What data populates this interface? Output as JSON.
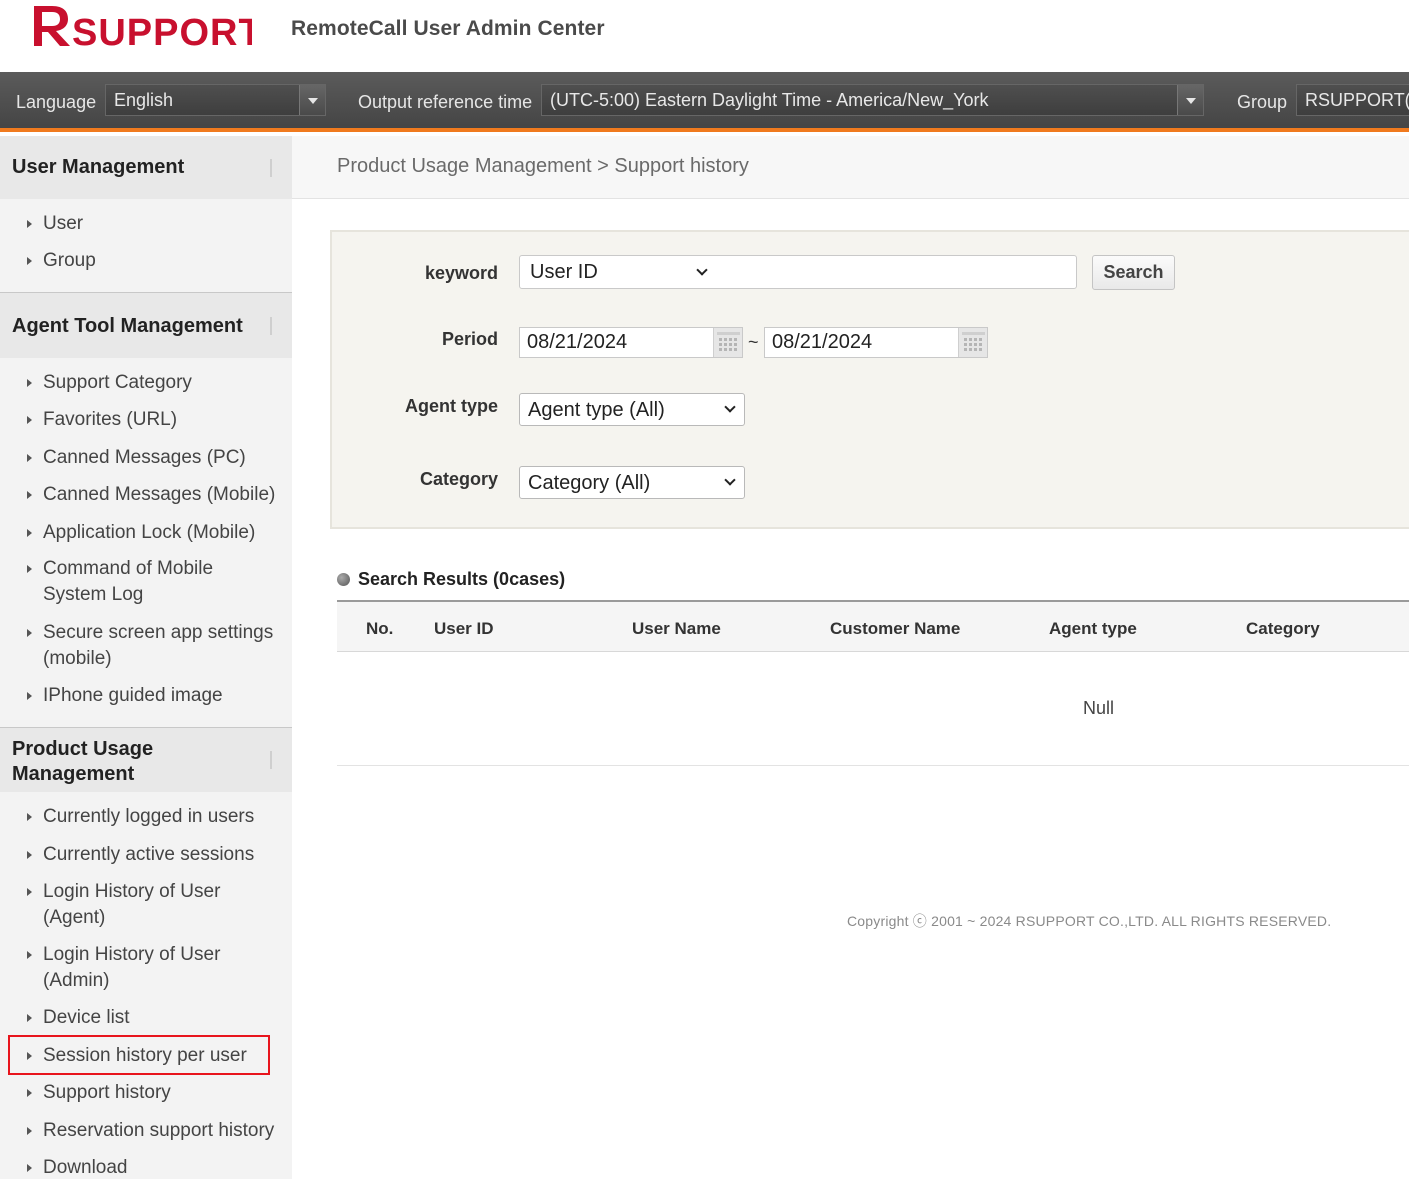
{
  "header": {
    "logo_text": "RSUPPORT",
    "app_title": "RemoteCall User Admin Center"
  },
  "topbar": {
    "language_label": "Language",
    "language_value": "English",
    "time_label": "Output reference time",
    "time_value": "(UTC-5:00) Eastern Daylight Time - America/New_York",
    "group_label": "Group",
    "group_value": "RSUPPORT("
  },
  "sidebar": {
    "user_management": {
      "title": "User Management",
      "items": [
        "User",
        "Group"
      ]
    },
    "agent_tool_management": {
      "title": "Agent Tool Management",
      "items": [
        "Support Category",
        "Favorites (URL)",
        "Canned Messages (PC)",
        "Canned Messages (Mobile)",
        "Application Lock (Mobile)",
        "Command of Mobile System Log",
        "Secure screen app settings (mobile)",
        "IPhone guided image"
      ]
    },
    "product_usage_management": {
      "title": "Product Usage Management",
      "items": [
        "Currently logged in users",
        "Currently active sessions",
        "Login History of User (Agent)",
        "Login History of User (Admin)",
        "Device list",
        "Session history per user",
        "Support history",
        "Reservation support history",
        "Download"
      ]
    }
  },
  "breadcrumb": "Product Usage Management > Support history",
  "search": {
    "keyword_label": "keyword",
    "keyword_type": "User ID",
    "search_button": "Search",
    "period_label": "Period",
    "date_from": "08/21/2024",
    "date_sep": "~",
    "date_to": "08/21/2024",
    "agent_type_label": "Agent type",
    "agent_type_value": "Agent type (All)",
    "category_label": "Category",
    "category_value": "Category (All)"
  },
  "results": {
    "title": "Search Results (0cases)",
    "columns": [
      "No.",
      "User ID",
      "User Name",
      "Customer Name",
      "Agent type",
      "Category"
    ],
    "empty_text": "Null"
  },
  "footer": {
    "copyright": "Copyright ⓒ 2001 ~ 2024 RSUPPORT CO.,LTD. ALL RIGHTS RESERVED."
  },
  "colors": {
    "accent_orange": "#f07a1e",
    "logo_red": "#c8102e",
    "highlight_red": "#e8141c"
  }
}
